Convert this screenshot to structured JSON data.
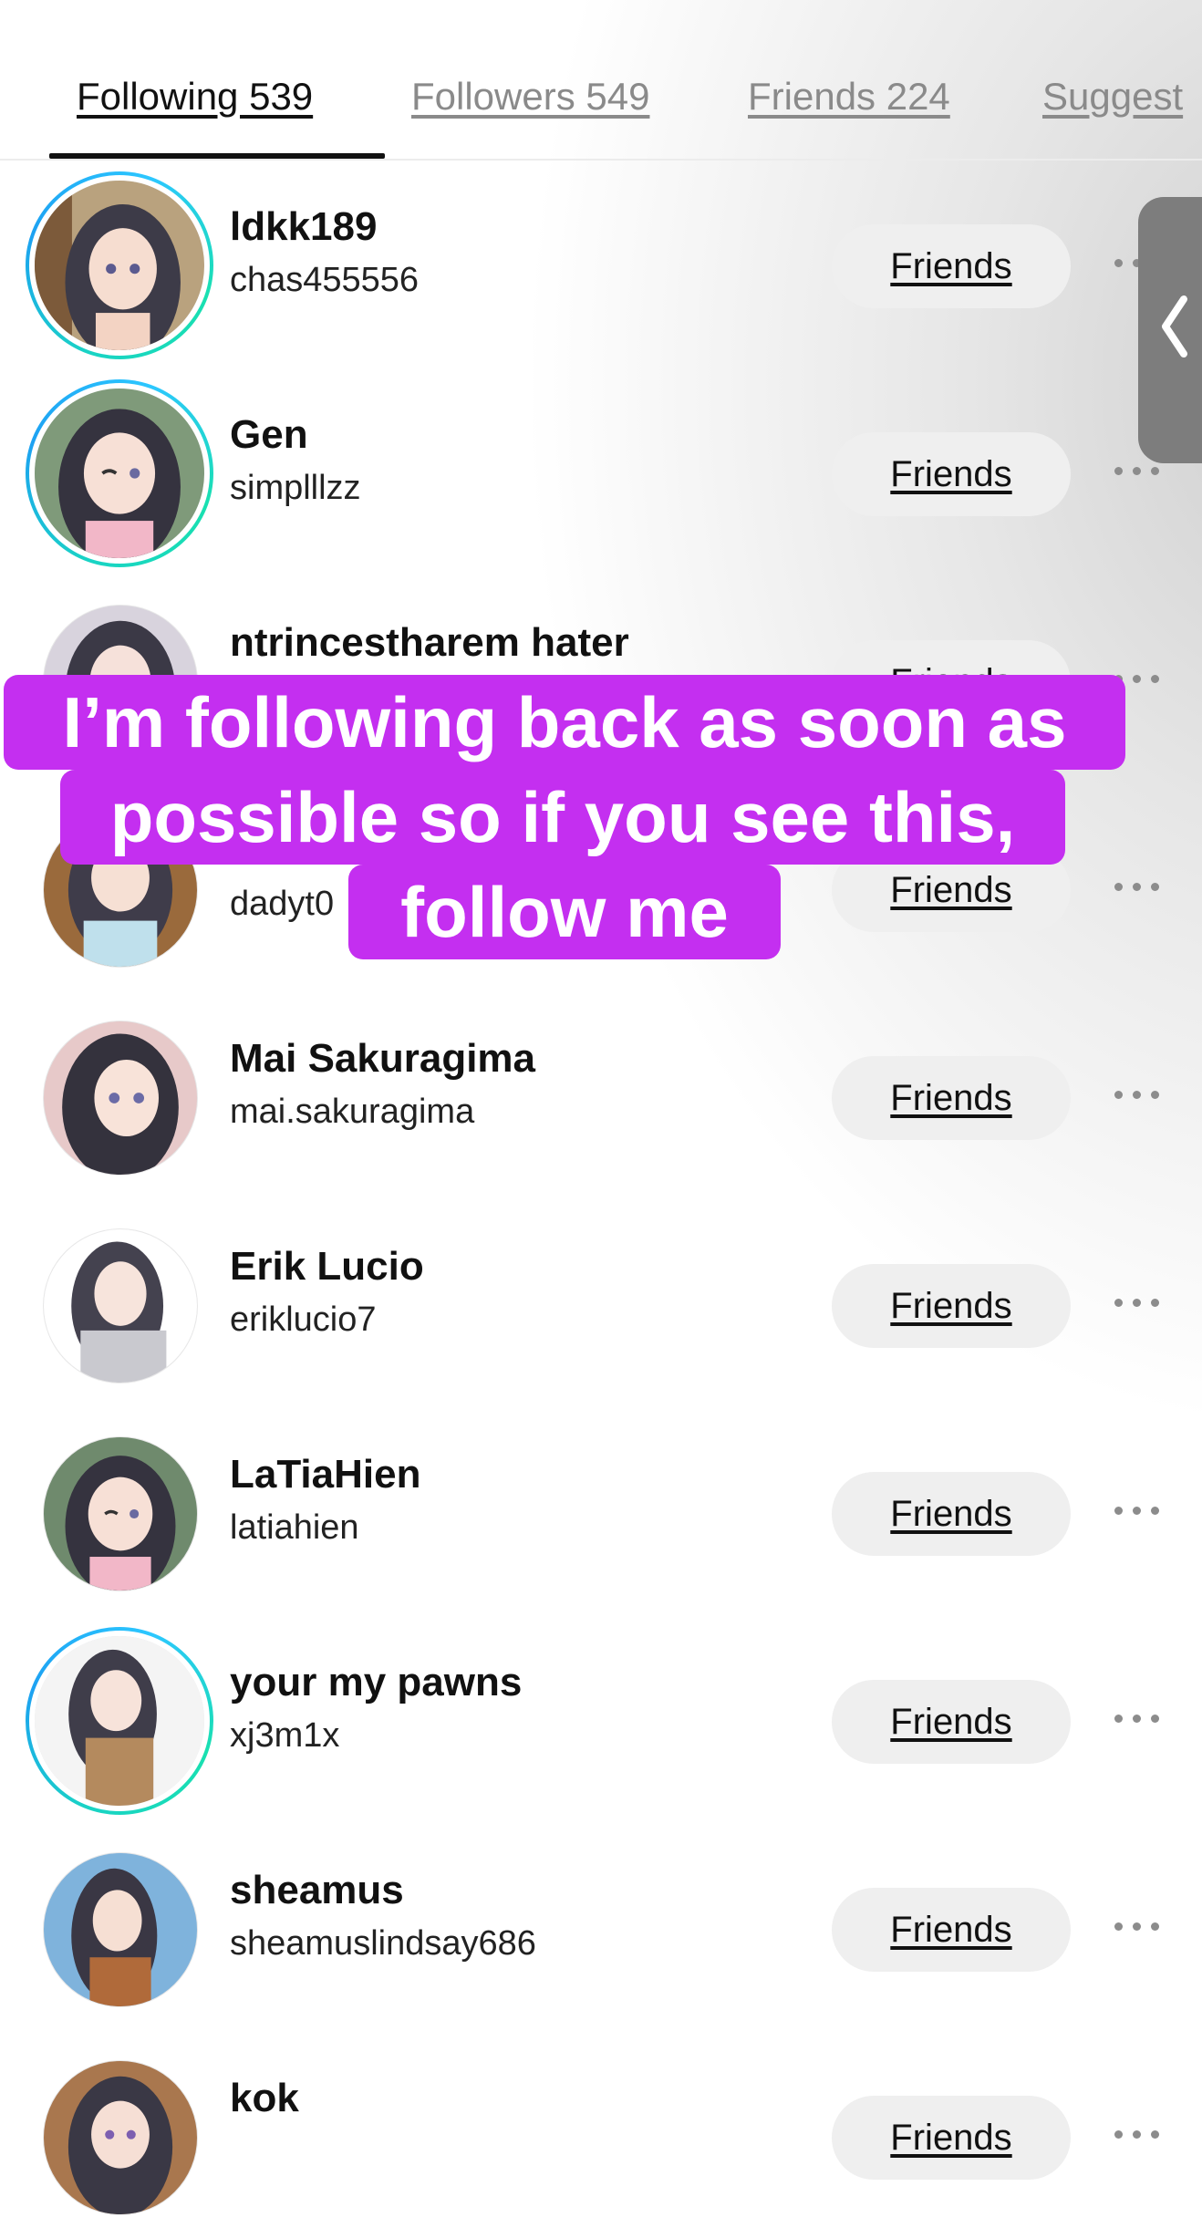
{
  "tabs": [
    {
      "label": "Following 539",
      "active": true
    },
    {
      "label": "Followers 549",
      "active": false
    },
    {
      "label": "Friends 224",
      "active": false
    },
    {
      "label": "Suggest",
      "active": false
    }
  ],
  "rows": [
    {
      "name": "ldkk189",
      "handle": "chas455556",
      "button": "Friends",
      "story_ring": true
    },
    {
      "name": "Gen",
      "handle": "simplllzz",
      "button": "Friends",
      "story_ring": true
    },
    {
      "name": "ntrincestharem hater",
      "handle": "",
      "button": "Friends",
      "story_ring": false
    },
    {
      "name": "",
      "handle": "dadyt0",
      "button": "Friends",
      "story_ring": false
    },
    {
      "name": "Mai Sakuragima",
      "handle": "mai.sakuragima",
      "button": "Friends",
      "story_ring": false
    },
    {
      "name": "Erik Lucio",
      "handle": "eriklucio7",
      "button": "Friends",
      "story_ring": false
    },
    {
      "name": "LaTiaHien",
      "handle": "latiahien",
      "button": "Friends",
      "story_ring": false
    },
    {
      "name": "your my pawns",
      "handle": "xj3m1x",
      "button": "Friends",
      "story_ring": true
    },
    {
      "name": "sheamus",
      "handle": "sheamuslindsay686",
      "button": "Friends",
      "story_ring": false
    },
    {
      "name": "kok",
      "handle": "",
      "button": "Friends",
      "story_ring": false
    }
  ],
  "caption": {
    "line1": "I’m following back as soon as",
    "line2": "possible so if you see this,",
    "line3": "follow me"
  },
  "colors": {
    "caption_bg": "#c42ff0",
    "button_bg": "#efefef",
    "story_ring": "#1da1f2"
  },
  "icons": {
    "more": "more-horizontal-icon",
    "side_handle": "chevron-left-icon"
  }
}
